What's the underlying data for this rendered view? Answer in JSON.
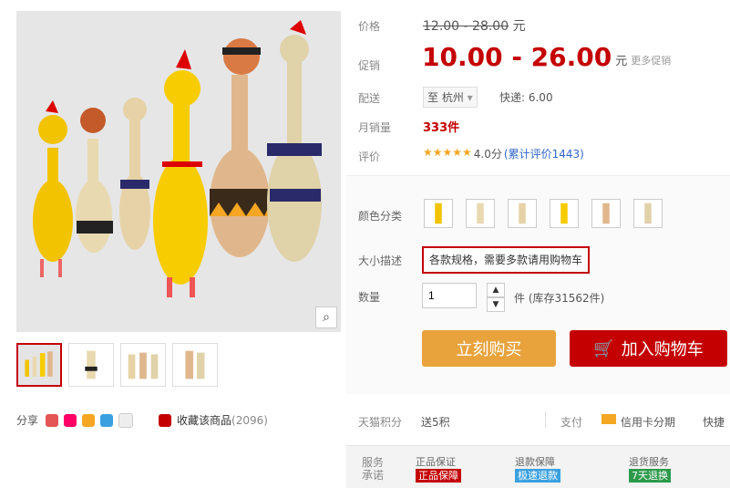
{
  "gallery": {
    "zoom_icon": "magnifier-icon"
  },
  "share": {
    "label": "分享",
    "collect_label": "收藏该商品",
    "collect_count": "(2096)"
  },
  "price": {
    "label": "价格",
    "original": "12.00 - 28.00",
    "unit": "元"
  },
  "promo": {
    "label": "促销",
    "value": "10.00 - 26.00",
    "unit": "元",
    "more": "更多促销"
  },
  "delivery": {
    "label": "配送",
    "to": "至 杭州",
    "express": "快递: 6.00"
  },
  "monthly": {
    "label": "月销量",
    "value": "333件"
  },
  "rating": {
    "label": "评价",
    "stars": "★★★★★",
    "score": "4.0分",
    "count": "(累计评价1443)"
  },
  "color": {
    "label": "颜色分类",
    "count": 6
  },
  "size": {
    "label": "大小描述",
    "value": "各款规格，需要多款请用购物车"
  },
  "quantity": {
    "label": "数量",
    "value": "1",
    "stock": "件 (库存31562件)"
  },
  "buttons": {
    "buy": "立刻购买",
    "cart": "加入购物车"
  },
  "footer": {
    "tmall_label": "天猫积分",
    "tmall_value": "送5积",
    "pay_label": "支付",
    "credit": "信用卡分期",
    "fast": "快捷"
  },
  "service": {
    "label1": "服务",
    "label2": "承诺",
    "col1": "正品保证",
    "col1_badge": "正品保障",
    "col2": "退款保障",
    "col2_badge": "极速退款",
    "col3": "退货服务",
    "col3_badge": "7天退换",
    "colors": {
      "red": "#c40000",
      "accent": "#e8a33d"
    }
  }
}
